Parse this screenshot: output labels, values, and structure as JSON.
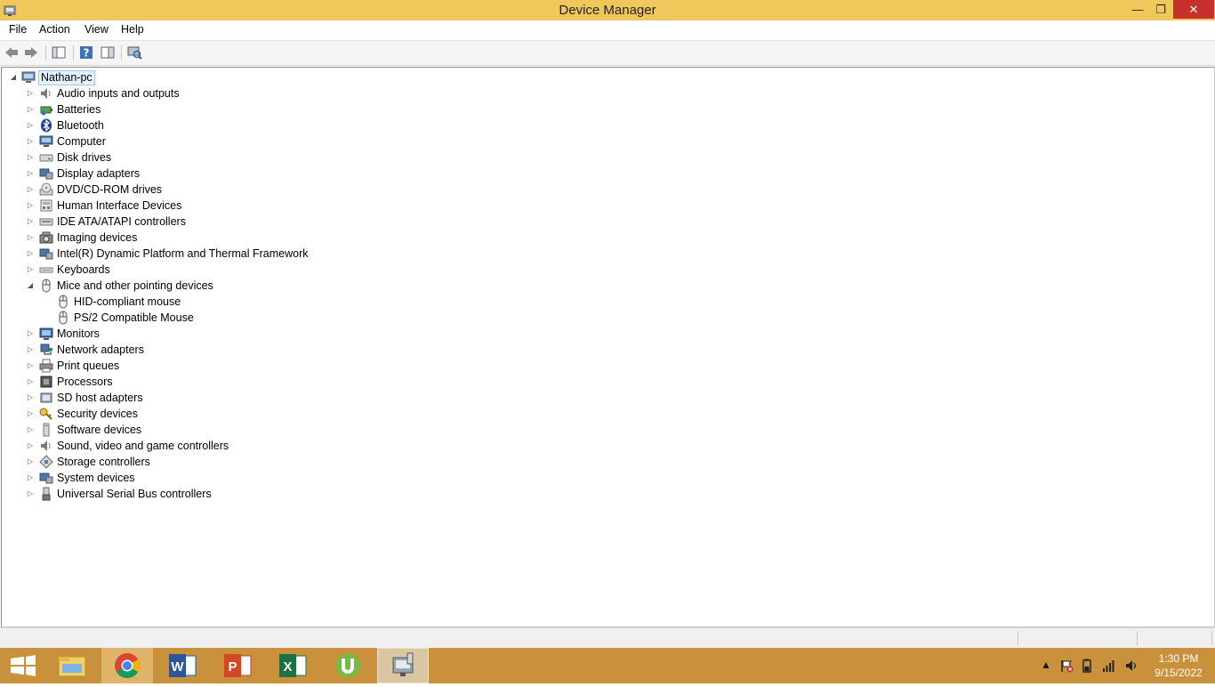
{
  "window": {
    "title": "Device Manager"
  },
  "menu": {
    "items": [
      "File",
      "Action",
      "View",
      "Help"
    ]
  },
  "tree": {
    "root": "Nathan-pc",
    "categories": [
      {
        "label": "Audio inputs and outputs",
        "icon": "speaker-icon",
        "expanded": false
      },
      {
        "label": "Batteries",
        "icon": "battery-icon",
        "expanded": false
      },
      {
        "label": "Bluetooth",
        "icon": "bluetooth-icon",
        "expanded": false
      },
      {
        "label": "Computer",
        "icon": "computer-icon",
        "expanded": false
      },
      {
        "label": "Disk drives",
        "icon": "disk-drive-icon",
        "expanded": false
      },
      {
        "label": "Display adapters",
        "icon": "display-adapter-icon",
        "expanded": false
      },
      {
        "label": "DVD/CD-ROM drives",
        "icon": "dvd-drive-icon",
        "expanded": false
      },
      {
        "label": "Human Interface Devices",
        "icon": "hid-icon",
        "expanded": false
      },
      {
        "label": "IDE ATA/ATAPI controllers",
        "icon": "ide-controller-icon",
        "expanded": false
      },
      {
        "label": "Imaging devices",
        "icon": "camera-icon",
        "expanded": false
      },
      {
        "label": "Intel(R) Dynamic Platform and Thermal Framework",
        "icon": "chip-icon",
        "expanded": false
      },
      {
        "label": "Keyboards",
        "icon": "keyboard-icon",
        "expanded": false
      },
      {
        "label": "Mice and other pointing devices",
        "icon": "mouse-icon",
        "expanded": true,
        "children": [
          {
            "label": "HID-compliant mouse",
            "icon": "mouse-icon"
          },
          {
            "label": "PS/2 Compatible Mouse",
            "icon": "mouse-icon"
          }
        ]
      },
      {
        "label": "Monitors",
        "icon": "monitor-icon",
        "expanded": false
      },
      {
        "label": "Network adapters",
        "icon": "network-adapter-icon",
        "expanded": false
      },
      {
        "label": "Print queues",
        "icon": "printer-icon",
        "expanded": false
      },
      {
        "label": "Processors",
        "icon": "processor-icon",
        "expanded": false
      },
      {
        "label": "SD host adapters",
        "icon": "sd-card-icon",
        "expanded": false
      },
      {
        "label": "Security devices",
        "icon": "key-icon",
        "expanded": false
      },
      {
        "label": "Software devices",
        "icon": "software-device-icon",
        "expanded": false
      },
      {
        "label": "Sound, video and game controllers",
        "icon": "speaker-icon",
        "expanded": false
      },
      {
        "label": "Storage controllers",
        "icon": "storage-controller-icon",
        "expanded": false
      },
      {
        "label": "System devices",
        "icon": "system-device-icon",
        "expanded": false
      },
      {
        "label": "Universal Serial Bus controllers",
        "icon": "usb-icon",
        "expanded": false
      }
    ]
  },
  "taskbar": {
    "apps": [
      "windows-start",
      "file-explorer",
      "chrome",
      "word",
      "powerpoint",
      "excel",
      "utorrent",
      "device-manager"
    ],
    "clock": {
      "time": "1:30 PM",
      "date": "9/15/2022"
    }
  },
  "colors": {
    "titlebar": "#f0c75a",
    "taskbar": "#c9913b",
    "close": "#c7302b"
  }
}
